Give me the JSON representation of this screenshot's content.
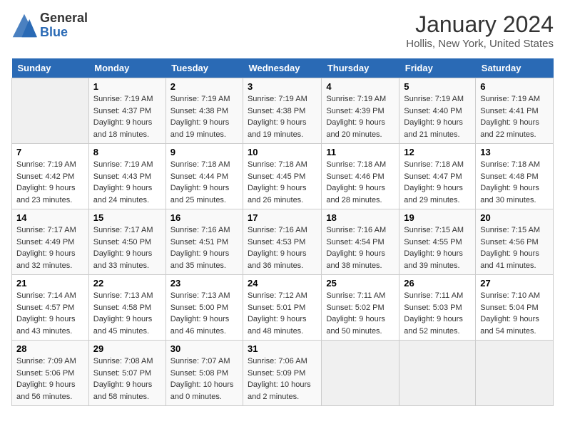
{
  "logo": {
    "general": "General",
    "blue": "Blue"
  },
  "header": {
    "title": "January 2024",
    "subtitle": "Hollis, New York, United States"
  },
  "days_of_week": [
    "Sunday",
    "Monday",
    "Tuesday",
    "Wednesday",
    "Thursday",
    "Friday",
    "Saturday"
  ],
  "weeks": [
    [
      {
        "day": "",
        "sunrise": "",
        "sunset": "",
        "daylight": ""
      },
      {
        "day": "1",
        "sunrise": "Sunrise: 7:19 AM",
        "sunset": "Sunset: 4:37 PM",
        "daylight": "Daylight: 9 hours and 18 minutes."
      },
      {
        "day": "2",
        "sunrise": "Sunrise: 7:19 AM",
        "sunset": "Sunset: 4:38 PM",
        "daylight": "Daylight: 9 hours and 19 minutes."
      },
      {
        "day": "3",
        "sunrise": "Sunrise: 7:19 AM",
        "sunset": "Sunset: 4:38 PM",
        "daylight": "Daylight: 9 hours and 19 minutes."
      },
      {
        "day": "4",
        "sunrise": "Sunrise: 7:19 AM",
        "sunset": "Sunset: 4:39 PM",
        "daylight": "Daylight: 9 hours and 20 minutes."
      },
      {
        "day": "5",
        "sunrise": "Sunrise: 7:19 AM",
        "sunset": "Sunset: 4:40 PM",
        "daylight": "Daylight: 9 hours and 21 minutes."
      },
      {
        "day": "6",
        "sunrise": "Sunrise: 7:19 AM",
        "sunset": "Sunset: 4:41 PM",
        "daylight": "Daylight: 9 hours and 22 minutes."
      }
    ],
    [
      {
        "day": "7",
        "sunrise": "Sunrise: 7:19 AM",
        "sunset": "Sunset: 4:42 PM",
        "daylight": "Daylight: 9 hours and 23 minutes."
      },
      {
        "day": "8",
        "sunrise": "Sunrise: 7:19 AM",
        "sunset": "Sunset: 4:43 PM",
        "daylight": "Daylight: 9 hours and 24 minutes."
      },
      {
        "day": "9",
        "sunrise": "Sunrise: 7:18 AM",
        "sunset": "Sunset: 4:44 PM",
        "daylight": "Daylight: 9 hours and 25 minutes."
      },
      {
        "day": "10",
        "sunrise": "Sunrise: 7:18 AM",
        "sunset": "Sunset: 4:45 PM",
        "daylight": "Daylight: 9 hours and 26 minutes."
      },
      {
        "day": "11",
        "sunrise": "Sunrise: 7:18 AM",
        "sunset": "Sunset: 4:46 PM",
        "daylight": "Daylight: 9 hours and 28 minutes."
      },
      {
        "day": "12",
        "sunrise": "Sunrise: 7:18 AM",
        "sunset": "Sunset: 4:47 PM",
        "daylight": "Daylight: 9 hours and 29 minutes."
      },
      {
        "day": "13",
        "sunrise": "Sunrise: 7:18 AM",
        "sunset": "Sunset: 4:48 PM",
        "daylight": "Daylight: 9 hours and 30 minutes."
      }
    ],
    [
      {
        "day": "14",
        "sunrise": "Sunrise: 7:17 AM",
        "sunset": "Sunset: 4:49 PM",
        "daylight": "Daylight: 9 hours and 32 minutes."
      },
      {
        "day": "15",
        "sunrise": "Sunrise: 7:17 AM",
        "sunset": "Sunset: 4:50 PM",
        "daylight": "Daylight: 9 hours and 33 minutes."
      },
      {
        "day": "16",
        "sunrise": "Sunrise: 7:16 AM",
        "sunset": "Sunset: 4:51 PM",
        "daylight": "Daylight: 9 hours and 35 minutes."
      },
      {
        "day": "17",
        "sunrise": "Sunrise: 7:16 AM",
        "sunset": "Sunset: 4:53 PM",
        "daylight": "Daylight: 9 hours and 36 minutes."
      },
      {
        "day": "18",
        "sunrise": "Sunrise: 7:16 AM",
        "sunset": "Sunset: 4:54 PM",
        "daylight": "Daylight: 9 hours and 38 minutes."
      },
      {
        "day": "19",
        "sunrise": "Sunrise: 7:15 AM",
        "sunset": "Sunset: 4:55 PM",
        "daylight": "Daylight: 9 hours and 39 minutes."
      },
      {
        "day": "20",
        "sunrise": "Sunrise: 7:15 AM",
        "sunset": "Sunset: 4:56 PM",
        "daylight": "Daylight: 9 hours and 41 minutes."
      }
    ],
    [
      {
        "day": "21",
        "sunrise": "Sunrise: 7:14 AM",
        "sunset": "Sunset: 4:57 PM",
        "daylight": "Daylight: 9 hours and 43 minutes."
      },
      {
        "day": "22",
        "sunrise": "Sunrise: 7:13 AM",
        "sunset": "Sunset: 4:58 PM",
        "daylight": "Daylight: 9 hours and 45 minutes."
      },
      {
        "day": "23",
        "sunrise": "Sunrise: 7:13 AM",
        "sunset": "Sunset: 5:00 PM",
        "daylight": "Daylight: 9 hours and 46 minutes."
      },
      {
        "day": "24",
        "sunrise": "Sunrise: 7:12 AM",
        "sunset": "Sunset: 5:01 PM",
        "daylight": "Daylight: 9 hours and 48 minutes."
      },
      {
        "day": "25",
        "sunrise": "Sunrise: 7:11 AM",
        "sunset": "Sunset: 5:02 PM",
        "daylight": "Daylight: 9 hours and 50 minutes."
      },
      {
        "day": "26",
        "sunrise": "Sunrise: 7:11 AM",
        "sunset": "Sunset: 5:03 PM",
        "daylight": "Daylight: 9 hours and 52 minutes."
      },
      {
        "day": "27",
        "sunrise": "Sunrise: 7:10 AM",
        "sunset": "Sunset: 5:04 PM",
        "daylight": "Daylight: 9 hours and 54 minutes."
      }
    ],
    [
      {
        "day": "28",
        "sunrise": "Sunrise: 7:09 AM",
        "sunset": "Sunset: 5:06 PM",
        "daylight": "Daylight: 9 hours and 56 minutes."
      },
      {
        "day": "29",
        "sunrise": "Sunrise: 7:08 AM",
        "sunset": "Sunset: 5:07 PM",
        "daylight": "Daylight: 9 hours and 58 minutes."
      },
      {
        "day": "30",
        "sunrise": "Sunrise: 7:07 AM",
        "sunset": "Sunset: 5:08 PM",
        "daylight": "Daylight: 10 hours and 0 minutes."
      },
      {
        "day": "31",
        "sunrise": "Sunrise: 7:06 AM",
        "sunset": "Sunset: 5:09 PM",
        "daylight": "Daylight: 10 hours and 2 minutes."
      },
      {
        "day": "",
        "sunrise": "",
        "sunset": "",
        "daylight": ""
      },
      {
        "day": "",
        "sunrise": "",
        "sunset": "",
        "daylight": ""
      },
      {
        "day": "",
        "sunrise": "",
        "sunset": "",
        "daylight": ""
      }
    ]
  ]
}
